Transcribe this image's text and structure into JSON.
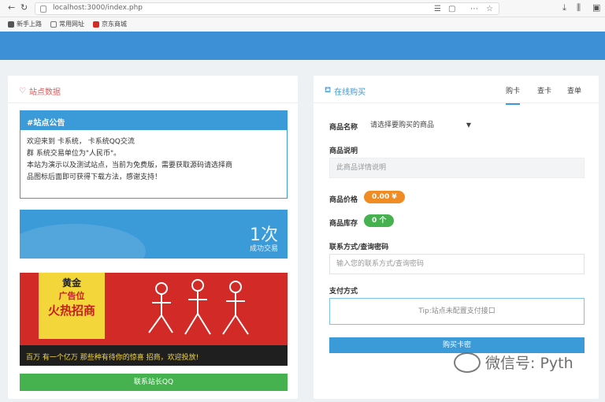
{
  "browser": {
    "url": "localhost:3000/index.php",
    "bookmarks": [
      "新手上路",
      "常用网址",
      "京东商城"
    ],
    "colors": {
      "chrome": "#f7f7f7",
      "header": "#3d8fd6"
    }
  },
  "left": {
    "title": "站点数据",
    "notice_title": "#站点公告",
    "notice_lines": [
      "欢迎来到 卡系统， 卡系统QQ交流",
      "群 系统交易单位为\"人民币\"。",
      "本站为演示以及测试站点，当前为免费版，需要获取源码请选择商",
      "品图标后面即可获得下载方法，感谢支持！"
    ],
    "stat_value": "1次",
    "stat_label": "成功交易",
    "banner": {
      "line1": "黄金",
      "line2": "广告位",
      "line3": "火热招商",
      "footer": "百万 有一个亿万 那些种有待你的惊喜 招商，欢迎投放!"
    },
    "button_label": "联系站长QQ"
  },
  "right": {
    "title": "在线购买",
    "tabs": [
      "购卡",
      "查卡",
      "查单"
    ],
    "product_name_label": "商品名称",
    "product_select": "请选择要购买的商品",
    "description_label": "商品说明",
    "description_placeholder": "此商品详情说明",
    "price_label": "商品价格",
    "price_value": "0.00 ¥",
    "stock_label": "商品库存",
    "stock_value": "0 个",
    "contact_label": "联系方式/查询密码",
    "contact_placeholder": "输入您的联系方式/查询密码",
    "payment_label": "支付方式",
    "payment_box": "Tip:站点未配置支付接口",
    "buy_button": "购买卡密"
  },
  "watermark": "微信号: Pyth",
  "colors": {
    "primary": "#3b9ad8",
    "price": "#f08c24",
    "stock": "#45b14f",
    "banner": "#d22a26"
  }
}
